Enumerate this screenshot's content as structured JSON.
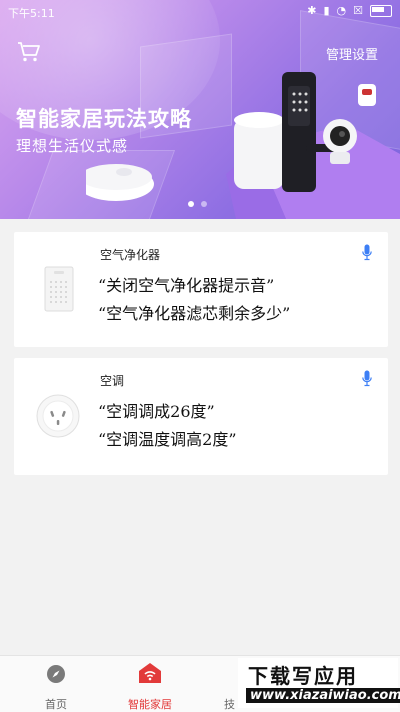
{
  "status_bar": {
    "time": "下午5:11"
  },
  "header": {
    "manage_label": "管理设置",
    "cart_icon": "cart-icon"
  },
  "banner": {
    "title": "智能家居玩法攻略",
    "subtitle": "理想生活仪式感",
    "page_count": 2,
    "active_page": 1
  },
  "cards": [
    {
      "name": "空气净化器",
      "commands": [
        "“关闭空气净化器提示音”",
        "“空气净化器滤芯剩余多少”"
      ],
      "icon": "air-purifier-image"
    },
    {
      "name": "空调",
      "commands": [
        "“空调调成26度”",
        "“空调温度调高2度”"
      ],
      "icon": "ac-socket-image"
    }
  ],
  "tabbar": {
    "tabs": [
      {
        "label": "首页",
        "icon": "compass-icon",
        "active": false
      },
      {
        "label": "智能家居",
        "icon": "smart-home-icon",
        "active": true
      },
      {
        "label": "技",
        "icon": "skills-icon",
        "active": false
      }
    ]
  },
  "watermark": {
    "title": "下载写应用",
    "url": "www.xiazaiwiao.com"
  },
  "colors": {
    "accent": "#e23a3a",
    "mic": "#3d7ff5",
    "banner_start": "#d9a4ef",
    "banner_end": "#7a63dc"
  }
}
